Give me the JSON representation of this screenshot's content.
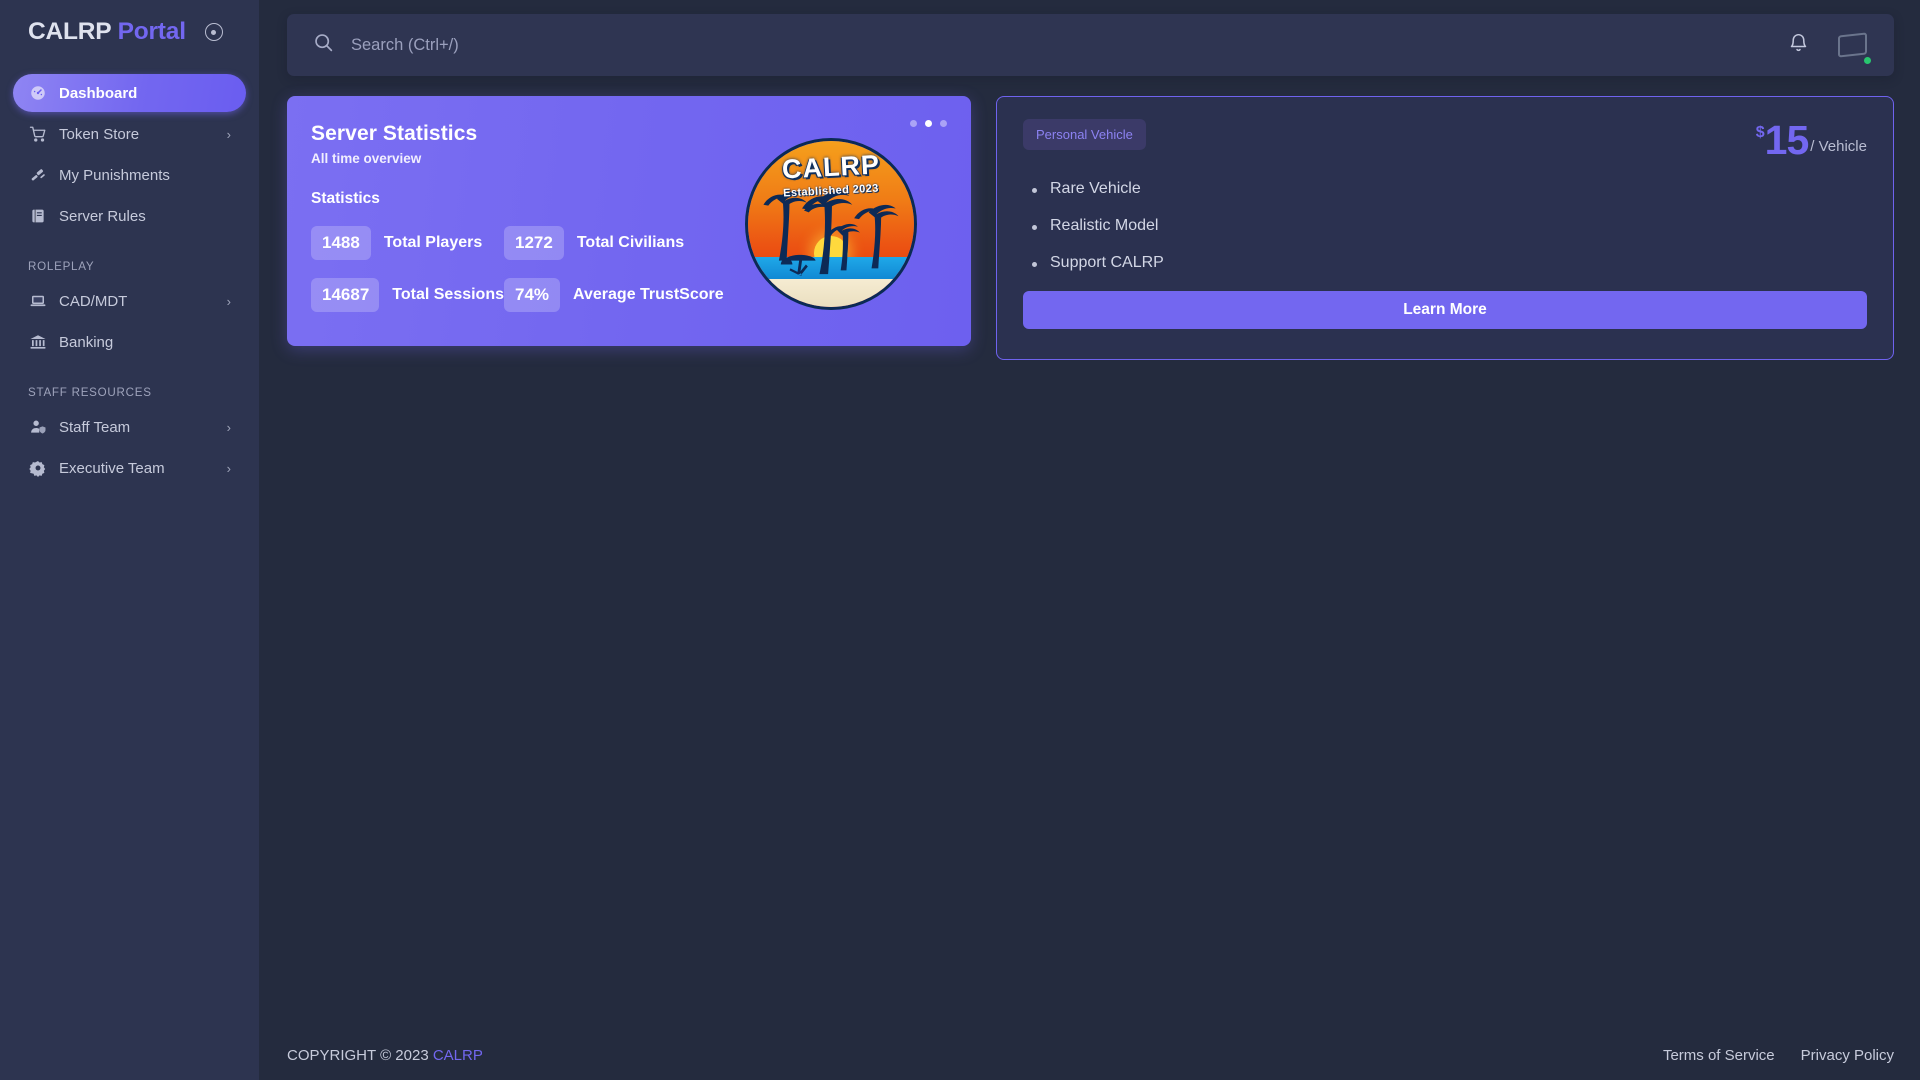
{
  "sidebar": {
    "brand": {
      "primary": "CALRP",
      "secondary": "Portal",
      "toggle_icon": "circle-dot-icon"
    },
    "items": [
      {
        "label": "Dashboard",
        "icon": "gauge-icon",
        "active": true,
        "chevron": ""
      },
      {
        "label": "Token Store",
        "icon": "cart-icon",
        "active": false,
        "chevron": "›"
      },
      {
        "label": "My Punishments",
        "icon": "gavel-icon",
        "active": false,
        "chevron": ""
      },
      {
        "label": "Server Rules",
        "icon": "book-icon",
        "active": false,
        "chevron": ""
      }
    ],
    "section_roleplay": "ROLEPLAY",
    "roleplay_items": [
      {
        "label": "CAD/MDT",
        "icon": "laptop-icon",
        "active": false,
        "chevron": "›"
      },
      {
        "label": "Banking",
        "icon": "bank-icon",
        "active": false,
        "chevron": ""
      }
    ],
    "section_staff": "STAFF RESOURCES",
    "staff_items": [
      {
        "label": "Staff Team",
        "icon": "user-shield-icon",
        "active": false,
        "chevron": "›"
      },
      {
        "label": "Executive Team",
        "icon": "gear-icon",
        "active": false,
        "chevron": "›"
      }
    ]
  },
  "header": {
    "search_placeholder": "Search (Ctrl+/)",
    "search_value": "",
    "search_icon": "search-icon",
    "bell_icon": "bell-icon",
    "avatar_status": "online"
  },
  "stats_card": {
    "title": "Server Statistics",
    "subtitle": "All time overview",
    "section_label": "Statistics",
    "stats": [
      {
        "value": "1488",
        "caption": "Total Players"
      },
      {
        "value": "1272",
        "caption": "Total Civilians"
      },
      {
        "value": "14687",
        "caption": "Total Sessions"
      },
      {
        "value": "74%",
        "caption": "Average TrustScore"
      }
    ],
    "carousel": {
      "count": 3,
      "active_index": 1
    },
    "logo": {
      "name": "CALRP",
      "tagline": "Established 2023"
    }
  },
  "offer_card": {
    "tag": "Personal Vehicle",
    "price_currency": "$",
    "price_amount": "15",
    "price_unit": "/ Vehicle",
    "features": [
      "Rare Vehicle",
      "Realistic Model",
      "Support CALRP"
    ],
    "cta_label": "Learn More"
  },
  "footer": {
    "copyright": "COPYRIGHT © 2023",
    "brand": "CALRP",
    "links": [
      "Terms of Service",
      "Privacy Policy"
    ]
  },
  "colors": {
    "accent": "#7367f0",
    "sidebar_bg": "#2d3450",
    "page_bg": "#242b3e",
    "card_bg": "#2b3150",
    "online": "#28c76f"
  }
}
